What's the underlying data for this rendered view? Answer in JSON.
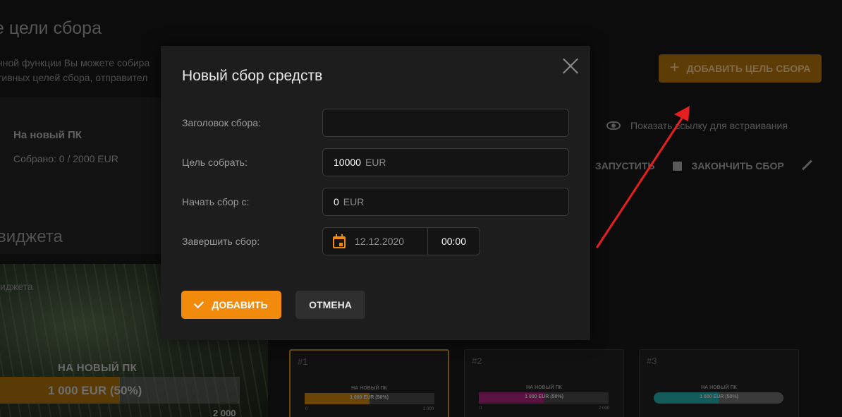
{
  "background": {
    "page_title": "е цели сбора",
    "description_lines": [
      "нной функции Вы можете собира",
      "тивных целей сбора, отправител"
    ],
    "add_goal_label": "ДОБАВИТЬ ЦЕЛЬ СБОРА",
    "goal": {
      "name": "На новый ПК",
      "collected_label": "Собрано:",
      "collected_value": "0 / 2000 EUR"
    },
    "embed_link_label": "Показать ссылку для встраивания",
    "start_label": "ЗАПУСТИТЬ",
    "finish_label": "ЗАКОНЧИТЬ СБОР",
    "widget_title": "виджета",
    "widget_subtitle": "иджета",
    "preview": {
      "name": "НА НОВЫЙ ПК",
      "amount": "1 000 EUR (50%)",
      "max": "2 000",
      "progress": 0.5
    },
    "styles": [
      {
        "num": "#1",
        "name": "НА НОВЫЙ ПК",
        "amount": "1 000 EUR (50%)",
        "min": "0",
        "max": "2 000",
        "color": "#6b4508",
        "progress": 0.5,
        "selected": true
      },
      {
        "num": "#2",
        "name": "НА НОВЫЙ ПК",
        "amount": "1 000 EUR (50%)",
        "min": "0",
        "max": "2 000",
        "color": "#5a1340",
        "progress": 0.5,
        "selected": false
      },
      {
        "num": "#3",
        "name": "НА НОВЫЙ ПК",
        "amount": "1 000 EUR (50%)",
        "min": "",
        "max": "",
        "color": "#135a5a",
        "progress": 0.5,
        "selected": false
      }
    ]
  },
  "modal": {
    "title": "Новый сбор средств",
    "fields": {
      "title_label": "Заголовок сбора:",
      "title_value": "",
      "goal_label": "Цель собрать:",
      "goal_value": "10000",
      "goal_unit": "EUR",
      "start_label": "Начать сбор с:",
      "start_value": "0",
      "start_unit": "EUR",
      "end_label": "Завершить сбор:",
      "end_date": "12.12.2020",
      "end_time": "00:00"
    },
    "add_label": "ДОБАВИТЬ",
    "cancel_label": "ОТМЕНА"
  },
  "colors": {
    "accent": "#f28b0c",
    "annotation": "#e51f1f"
  },
  "icons": [
    "plus-icon",
    "eye-icon",
    "stop-icon",
    "pencil-icon",
    "close-icon",
    "calendar-icon",
    "check-icon",
    "annotation-arrow"
  ]
}
